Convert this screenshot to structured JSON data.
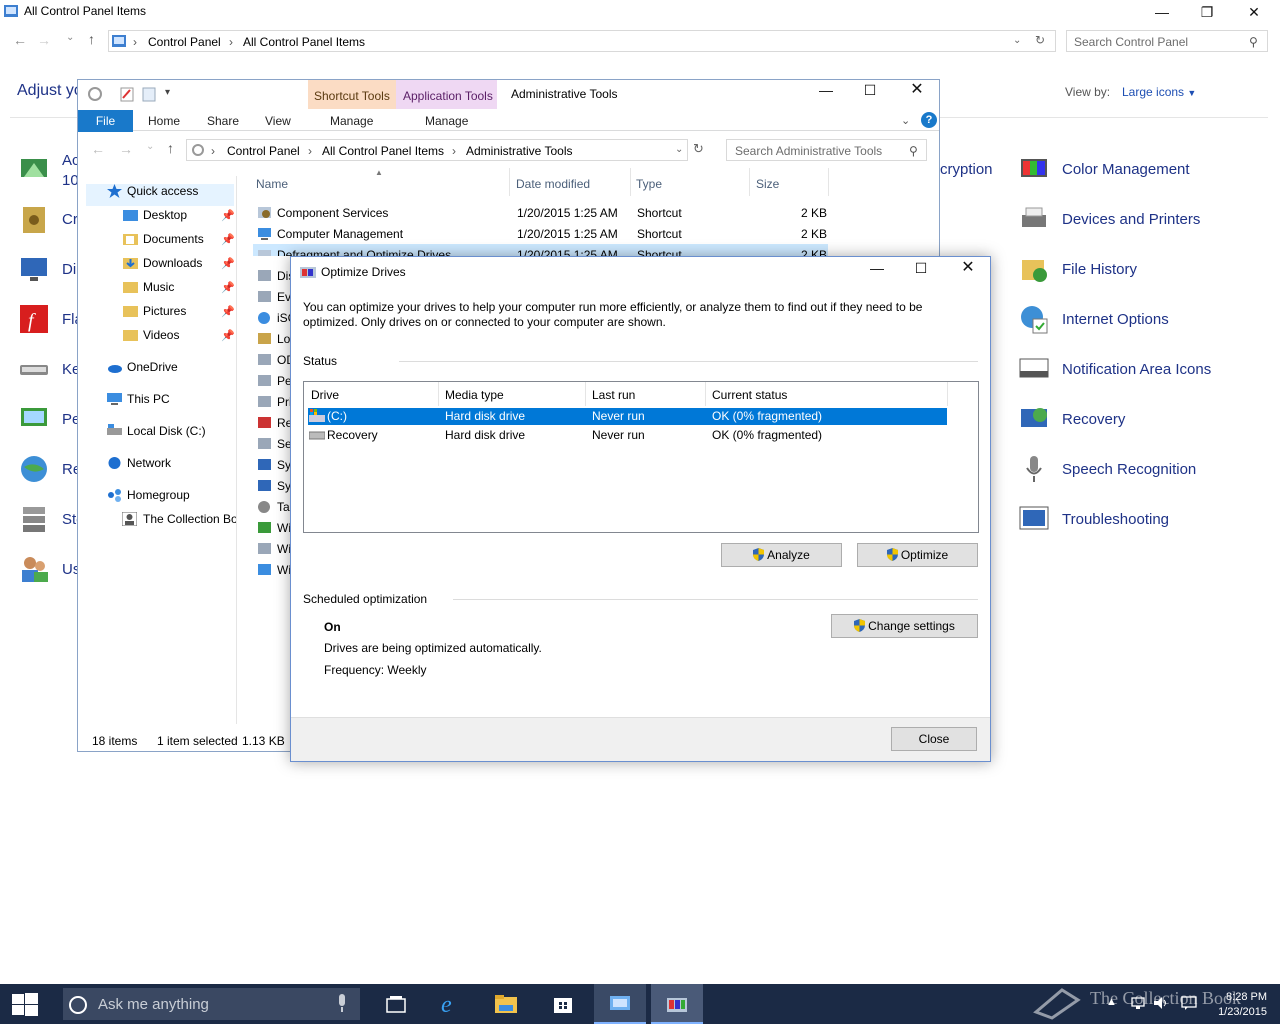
{
  "control_panel": {
    "window_title": "All Control Panel Items",
    "breadcrumb": [
      "Control Panel",
      "All Control Panel Items"
    ],
    "search_placeholder": "Search Control Panel",
    "heading": "Adjust yo",
    "view_by_label": "View by:",
    "view_by_value": "Large icons",
    "left_items": [
      "Ac",
      "10",
      "Cr",
      "Di",
      "Fla",
      "Ke",
      "Pe",
      "Re",
      "Sto",
      "Us"
    ],
    "partial_middle_item": "cryption",
    "right_items": [
      "Color Management",
      "Devices and Printers",
      "File History",
      "Internet Options",
      "Notification Area Icons",
      "Recovery",
      "Speech Recognition",
      "Troubleshooting"
    ]
  },
  "admin_tools": {
    "window_title": "Administrative Tools",
    "context_tabs": {
      "shortcut_tools": "Shortcut Tools",
      "application_tools": "Application Tools"
    },
    "ribbon_tabs": {
      "file": "File",
      "home": "Home",
      "share": "Share",
      "view": "View",
      "manage1": "Manage",
      "manage2": "Manage"
    },
    "breadcrumb": [
      "Control Panel",
      "All Control Panel Items",
      "Administrative Tools"
    ],
    "search_placeholder": "Search Administrative Tools",
    "nav": {
      "quick_access": "Quick access",
      "desktop": "Desktop",
      "documents": "Documents",
      "downloads": "Downloads",
      "music": "Music",
      "pictures": "Pictures",
      "videos": "Videos",
      "onedrive": "OneDrive",
      "this_pc": "This PC",
      "local_disk": "Local Disk (C:)",
      "network": "Network",
      "homegroup": "Homegroup",
      "collection": "The Collection Bo"
    },
    "columns": {
      "name": "Name",
      "date": "Date modified",
      "type": "Type",
      "size": "Size"
    },
    "files": [
      {
        "name": "Component Services",
        "date": "1/20/2015 1:25 AM",
        "type": "Shortcut",
        "size": "2 KB"
      },
      {
        "name": "Computer Management",
        "date": "1/20/2015 1:25 AM",
        "type": "Shortcut",
        "size": "2 KB"
      },
      {
        "name": "Defragment and Optimize Drives",
        "date": "1/20/2015 1:25 AM",
        "type": "Shortcut",
        "size": "2 KB"
      }
    ],
    "partial_files": [
      "Dis",
      "Eve",
      "iSC",
      "Lo",
      "OD",
      "Pe",
      "Pri",
      "Re",
      "Se",
      "Sys",
      "Sys",
      "Tas",
      "Wi",
      "Wi",
      "Wi"
    ],
    "status": {
      "items": "18 items",
      "selected": "1 item selected",
      "size": "1.13 KB"
    }
  },
  "optimize": {
    "title": "Optimize Drives",
    "description": "You can optimize your drives to help your computer run more efficiently, or analyze them to find out if they need to be optimized. Only drives on or connected to your computer are shown.",
    "status_label": "Status",
    "columns": {
      "drive": "Drive",
      "media": "Media type",
      "last_run": "Last run",
      "status": "Current status"
    },
    "drives": [
      {
        "drive": "(C:)",
        "media": "Hard disk drive",
        "last_run": "Never run",
        "status": "OK (0% fragmented)"
      },
      {
        "drive": "Recovery",
        "media": "Hard disk drive",
        "last_run": "Never run",
        "status": "OK (0% fragmented)"
      }
    ],
    "analyze": "Analyze",
    "optimize": "Optimize",
    "scheduled_label": "Scheduled optimization",
    "scheduled_state": "On",
    "scheduled_desc": "Drives are being optimized automatically.",
    "frequency": "Frequency: Weekly",
    "change_settings": "Change settings",
    "close": "Close"
  },
  "taskbar": {
    "search_placeholder": "Ask me anything",
    "time": "8:28 PM",
    "date": "1/23/2015",
    "watermark": "The Collection Book"
  },
  "colors": {
    "selection": "#0078d7",
    "file_tab": "#1979ca",
    "taskbar": "#1b2a45",
    "link": "#1e3287"
  }
}
